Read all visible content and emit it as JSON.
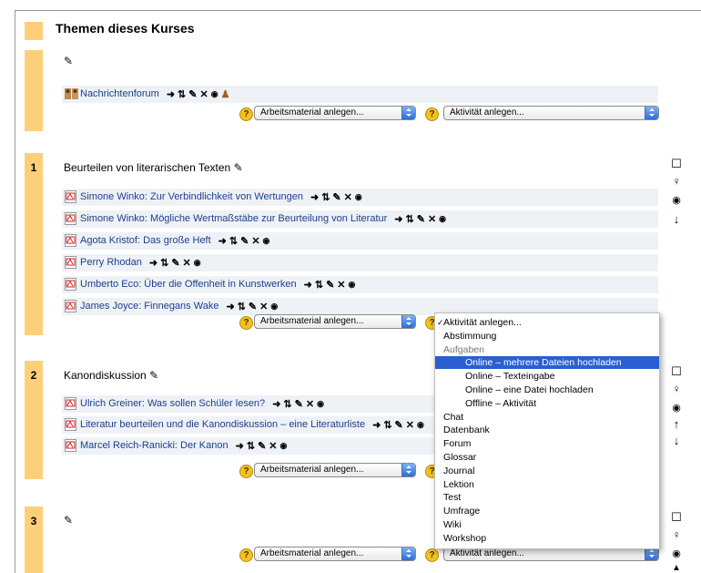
{
  "heading": "Themen dieses Kurses",
  "icons": {
    "edit": "pencil-icon",
    "move": "arrow-right-icon",
    "moveupdown": "move-updown-icon",
    "delete": "delete-icon",
    "visible": "eye-icon",
    "group": "person-icon",
    "highlight": "square-icon",
    "lightbulb": "lightbulb-icon",
    "down": "arrow-down-icon",
    "up": "arrow-up-icon"
  },
  "section0": {
    "forum": "Nachrichtenforum"
  },
  "selects": {
    "resource": "Arbeitsmaterial anlegen...",
    "activity": "Aktivität anlegen..."
  },
  "section1": {
    "number": "1",
    "title": "Beurteilen von literarischen Texten",
    "items": [
      "Simone Winko: Zur Verbindlichkeit von Wertungen",
      "Simone Winko: Mögliche Wertmaßstäbe zur Beurteilung von Literatur",
      "Agota Kristof: Das große Heft",
      "Perry Rhodan",
      "Umberto Eco: Über die Offenheit in Kunstwerken",
      "James Joyce: Finnegans Wake"
    ]
  },
  "section2": {
    "number": "2",
    "title": "Kanondiskussion",
    "items": [
      "Ulrich Greiner: Was sollen Schüler lesen?",
      "Literatur beurteilen und die Kanondiskussion – eine Literaturliste",
      "Marcel Reich-Ranicki: Der Kanon"
    ]
  },
  "section3": {
    "number": "3"
  },
  "dropdown": {
    "options": [
      "Aktivität anlegen...",
      "Abstimmung",
      "Aufgaben",
      "Online – mehrere Dateien hochladen",
      "Online – Texteingabe",
      "Online – eine Datei hochladen",
      "Offline – Aktivität",
      "Chat",
      "Datenbank",
      "Forum",
      "Glossar",
      "Journal",
      "Lektion",
      "Test",
      "Umfrage",
      "Wiki",
      "Workshop"
    ],
    "selected": "Aktivität anlegen...",
    "highlighted": "Online – mehrere Dateien hochladen",
    "group_label": "Aufgaben"
  },
  "glyphs": {
    "check": "✓",
    "help": "?",
    "move": "➜",
    "updown": "⇅",
    "edit": "✎",
    "del": "✕",
    "eye": "👁",
    "person": "♟",
    "square": "☐",
    "bulb": "💡",
    "down": "↓",
    "up": "↑"
  }
}
